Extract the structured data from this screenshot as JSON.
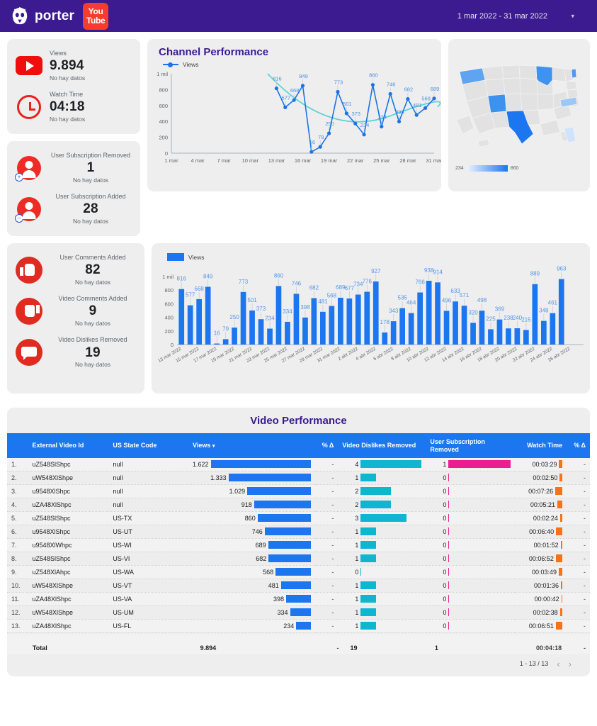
{
  "topbar": {
    "brand": "porter",
    "youtube_line1": "You",
    "youtube_line2": "Tube",
    "date_range": "1 mar 2022 - 31 mar 2022",
    "menu_glyph": "▾"
  },
  "scorecards": {
    "group1": [
      {
        "icon": "youtube-play-icon",
        "title": "Views",
        "value": "9.894",
        "sub": "No hay datos"
      },
      {
        "icon": "clock-icon",
        "title": "Watch Time",
        "value": "04:18",
        "sub": "No hay datos"
      }
    ],
    "group2": [
      {
        "icon": "user-minus-icon",
        "title": "User Subscription Removed",
        "value": "1",
        "sub": "No hay datos"
      },
      {
        "icon": "user-plus-icon",
        "title": "User Subscription Added",
        "value": "28",
        "sub": "No hay datos"
      }
    ],
    "group3": [
      {
        "icon": "thumbs-up-icon",
        "title": "User Comments Added",
        "value": "82",
        "sub": "No hay datos"
      },
      {
        "icon": "thumbs-down-icon",
        "title": "Video Comments Added",
        "value": "9",
        "sub": "No hay datos"
      },
      {
        "icon": "comment-bubble-icon",
        "title": "Video Dislikes Removed",
        "value": "19",
        "sub": "No hay datos"
      }
    ]
  },
  "chart_data": [
    {
      "type": "line",
      "name": "channel-performance",
      "title": "Channel Performance",
      "legend": [
        "Views"
      ],
      "legend_position": "top-left",
      "xlabel": "",
      "ylabel": "",
      "ylim": [
        0,
        1000
      ],
      "yticks": [
        "0",
        "200",
        "400",
        "600",
        "800",
        "1 mil"
      ],
      "ytick_values": [
        0,
        200,
        400,
        600,
        800,
        1000
      ],
      "xticks": [
        "1 mar",
        "4 mar",
        "7 mar",
        "10 mar",
        "13 mar",
        "16 mar",
        "19 mar",
        "22 mar",
        "25 mar",
        "28 mar",
        "31 mar"
      ],
      "grid": false,
      "x": [
        "13 mar",
        "14 mar",
        "15 mar",
        "16 mar",
        "17 mar",
        "18 mar",
        "19 mar",
        "20 mar",
        "21 mar",
        "22 mar",
        "23 mar",
        "24 mar",
        "25 mar",
        "26 mar",
        "27 mar",
        "28 mar",
        "29 mar",
        "30 mar",
        "31 mar"
      ],
      "values": [
        816,
        577,
        668,
        849,
        16,
        79,
        250,
        773,
        501,
        373,
        234,
        860,
        334,
        746,
        398,
        682,
        481,
        568,
        689
      ],
      "trend_line": true,
      "colors": {
        "series": "#1a73e8",
        "trend": "#5ed4d4",
        "labels": "#4a90e2"
      }
    },
    {
      "type": "bar",
      "name": "daily-views-bar",
      "legend": [
        "Views"
      ],
      "ylim": [
        0,
        1000
      ],
      "yticks": [
        "0",
        "200",
        "400",
        "600",
        "800",
        "1 mil"
      ],
      "ytick_values": [
        0,
        200,
        400,
        600,
        800,
        1000
      ],
      "categories": [
        "13 mar 2022",
        "14 mar 2022",
        "15 mar 2022",
        "16 mar 2022",
        "17 mar 2022",
        "18 mar 2022",
        "19 mar 2022",
        "20 mar 2022",
        "21 mar 2022",
        "22 mar 2022",
        "23 mar 2022",
        "24 mar 2022",
        "25 mar 2022",
        "26 mar 2022",
        "27 mar 2022",
        "28 mar 2022",
        "29 mar 2022",
        "30 mar 2022",
        "31 mar 2022",
        "1 abr 2022",
        "2 abr 2022",
        "3 abr 2022",
        "4 abr 2022",
        "5 abr 2022",
        "6 abr 2022",
        "7 abr 2022",
        "8 abr 2022",
        "9 abr 2022",
        "10 abr 2022",
        "11 abr 2022",
        "12 abr 2022",
        "13 abr 2022",
        "14 abr 2022",
        "15 abr 2022",
        "16 abr 2022",
        "17 abr 2022",
        "18 abr 2022",
        "19 abr 2022",
        "20 abr 2022",
        "21 abr 2022",
        "22 abr 2022",
        "23 abr 2022",
        "24 abr 2022",
        "25 abr 2022",
        "26 abr 2022",
        "27 abr 2022"
      ],
      "tick_labels": [
        "13 mar 2022",
        "15 mar 2022",
        "17 mar 2022",
        "19 mar 2022",
        "21 mar 2022",
        "23 mar 2022",
        "25 mar 2022",
        "27 mar 2022",
        "29 mar 2022",
        "31 mar 2022",
        "2 abr 2022",
        "4 abr 2022",
        "6 abr 2022",
        "8 abr 2022",
        "10 abr 2022",
        "12 abr 2022",
        "14 abr 2022",
        "16 abr 2022",
        "18 abr 2022",
        "20 abr 2022",
        "22 abr 2022",
        "24 abr 2022",
        "26 abr 2022"
      ],
      "values": [
        816,
        577,
        668,
        849,
        16,
        79,
        250,
        773,
        501,
        373,
        234,
        860,
        334,
        746,
        398,
        682,
        481,
        568,
        689,
        677,
        734,
        776,
        927,
        178,
        343,
        535,
        464,
        766,
        938,
        914,
        496,
        633,
        571,
        320,
        498,
        225,
        369,
        238,
        240,
        215,
        889,
        348,
        461,
        963,
        0,
        0
      ],
      "labels": [
        "816",
        "577",
        "668",
        "849",
        "16",
        "79",
        "250",
        "773",
        "501",
        "373",
        "234",
        "860",
        "334",
        "746",
        "398",
        "682",
        "481",
        "568",
        "689",
        "677",
        "734",
        "776",
        "927",
        "178",
        "343",
        "535",
        "464",
        "766",
        "938",
        "914",
        "496",
        "633",
        "571",
        "320",
        "498",
        "225",
        "369",
        "238",
        "240",
        "215",
        "889",
        "348",
        "461",
        "963",
        "",
        ""
      ],
      "colors": {
        "bar": "#1b76ef",
        "labels": "#5596e6"
      }
    }
  ],
  "map": {
    "name": "us-views-map",
    "legend_min": "234",
    "legend_max": "860",
    "highlighted_states": [
      {
        "code": "WA",
        "value": 568
      },
      {
        "code": "UT",
        "value": 746
      },
      {
        "code": "TX",
        "value": 860
      },
      {
        "code": "WI",
        "value": 689
      },
      {
        "code": "VT",
        "value": 481
      },
      {
        "code": "VA",
        "value": 398
      },
      {
        "code": "FL",
        "value": 234
      }
    ]
  },
  "table": {
    "title": "Video Performance",
    "columns": [
      {
        "label": "External Video Id",
        "align": "left"
      },
      {
        "label": "US State Code",
        "align": "left"
      },
      {
        "label": "Views",
        "align": "left",
        "sort": "▾"
      },
      {
        "label": "% Δ",
        "align": "right"
      },
      {
        "label": "Video Dislikes Removed",
        "align": "left"
      },
      {
        "label": "User Subscription Removed",
        "align": "left"
      },
      {
        "label": "Watch Time",
        "align": "right"
      },
      {
        "label": "% Δ",
        "align": "right"
      }
    ],
    "rows": [
      {
        "idx": "1.",
        "video_id": "uZ548SlShpc",
        "state": "null",
        "views": "1.622",
        "views_n": 1622,
        "delta1": "-",
        "dislikes": "4",
        "dislikes_n": 4,
        "subs": "1",
        "subs_n": 1,
        "watch": "00:03:29",
        "watch_n": 209,
        "delta2": "-"
      },
      {
        "idx": "2.",
        "video_id": "uW548XlShpe",
        "state": "null",
        "views": "1.333",
        "views_n": 1333,
        "delta1": "-",
        "dislikes": "1",
        "dislikes_n": 1,
        "subs": "0",
        "subs_n": 0,
        "watch": "00:02:50",
        "watch_n": 170,
        "delta2": "-"
      },
      {
        "idx": "3.",
        "video_id": "u9548XlShpc",
        "state": "null",
        "views": "1.029",
        "views_n": 1029,
        "delta1": "-",
        "dislikes": "2",
        "dislikes_n": 2,
        "subs": "0",
        "subs_n": 0,
        "watch": "00:07:26",
        "watch_n": 446,
        "delta2": "-"
      },
      {
        "idx": "4.",
        "video_id": "uZA48XlShpc",
        "state": "null",
        "views": "918",
        "views_n": 918,
        "delta1": "-",
        "dislikes": "2",
        "dislikes_n": 2,
        "subs": "0",
        "subs_n": 0,
        "watch": "00:05:21",
        "watch_n": 321,
        "delta2": "-"
      },
      {
        "idx": "5.",
        "video_id": "uZ548SlShpc",
        "state": "US-TX",
        "views": "860",
        "views_n": 860,
        "delta1": "-",
        "dislikes": "3",
        "dislikes_n": 3,
        "subs": "0",
        "subs_n": 0,
        "watch": "00:02:24",
        "watch_n": 144,
        "delta2": "-"
      },
      {
        "idx": "6.",
        "video_id": "u9548XlShpc",
        "state": "US-UT",
        "views": "746",
        "views_n": 746,
        "delta1": "-",
        "dislikes": "1",
        "dislikes_n": 1,
        "subs": "0",
        "subs_n": 0,
        "watch": "00:06:40",
        "watch_n": 400,
        "delta2": "-"
      },
      {
        "idx": "7.",
        "video_id": "u9548XlWhpc",
        "state": "US-WI",
        "views": "689",
        "views_n": 689,
        "delta1": "-",
        "dislikes": "1",
        "dislikes_n": 1,
        "subs": "0",
        "subs_n": 0,
        "watch": "00:01:52",
        "watch_n": 112,
        "delta2": "-"
      },
      {
        "idx": "8.",
        "video_id": "uZ548SlShpc",
        "state": "US-VI",
        "views": "682",
        "views_n": 682,
        "delta1": "-",
        "dislikes": "1",
        "dislikes_n": 1,
        "subs": "0",
        "subs_n": 0,
        "watch": "00:06:52",
        "watch_n": 412,
        "delta2": "-"
      },
      {
        "idx": "9.",
        "video_id": "uZ548XlAhpc",
        "state": "US-WA",
        "views": "568",
        "views_n": 568,
        "delta1": "-",
        "dislikes": "0",
        "dislikes_n": 0,
        "subs": "0",
        "subs_n": 0,
        "watch": "00:03:49",
        "watch_n": 229,
        "delta2": "-"
      },
      {
        "idx": "10.",
        "video_id": "uW548XlShpe",
        "state": "US-VT",
        "views": "481",
        "views_n": 481,
        "delta1": "-",
        "dislikes": "1",
        "dislikes_n": 1,
        "subs": "0",
        "subs_n": 0,
        "watch": "00:01:36",
        "watch_n": 96,
        "delta2": "-"
      },
      {
        "idx": "11.",
        "video_id": "uZA48XlShpc",
        "state": "US-VA",
        "views": "398",
        "views_n": 398,
        "delta1": "-",
        "dislikes": "1",
        "dislikes_n": 1,
        "subs": "0",
        "subs_n": 0,
        "watch": "00:00:42",
        "watch_n": 42,
        "delta2": "-"
      },
      {
        "idx": "12.",
        "video_id": "uW548XlShpe",
        "state": "US-UM",
        "views": "334",
        "views_n": 334,
        "delta1": "-",
        "dislikes": "1",
        "dislikes_n": 1,
        "subs": "0",
        "subs_n": 0,
        "watch": "00:02:38",
        "watch_n": 158,
        "delta2": "-"
      },
      {
        "idx": "13.",
        "video_id": "uZA48XlShpc",
        "state": "US-FL",
        "views": "234",
        "views_n": 234,
        "delta1": "-",
        "dislikes": "1",
        "dislikes_n": 1,
        "subs": "0",
        "subs_n": 0,
        "watch": "00:06:51",
        "watch_n": 411,
        "delta2": "-"
      }
    ],
    "total": {
      "label": "Total",
      "views": "9.894",
      "delta1": "-",
      "dislikes": "19",
      "subs": "1",
      "watch": "00:04:18",
      "delta2": "-"
    },
    "pagination": {
      "range": "1 - 13 / 13",
      "prev": "‹",
      "next": "›"
    }
  }
}
